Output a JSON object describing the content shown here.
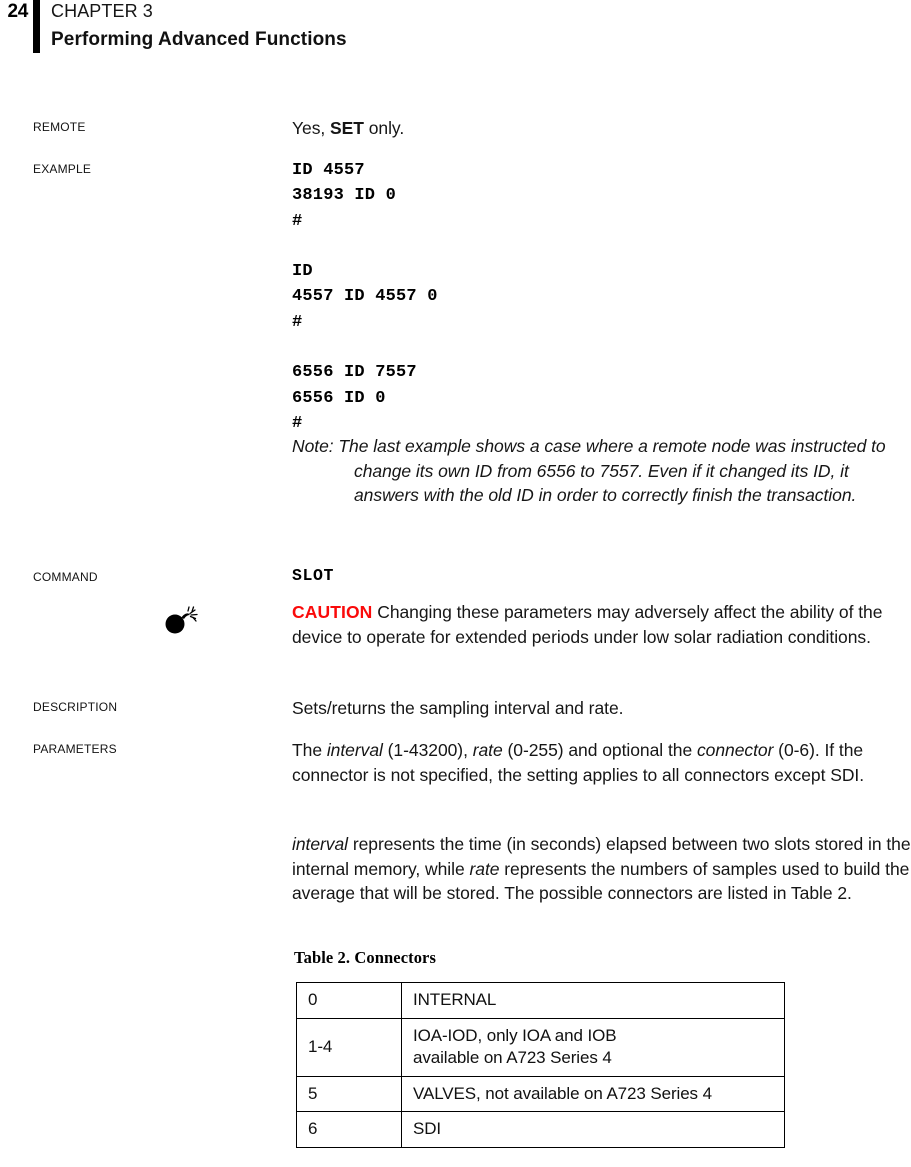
{
  "header": {
    "page_number": "24",
    "chapter_label": "CHAPTER 3",
    "chapter_title": "Performing Advanced Functions"
  },
  "entries": {
    "remote": {
      "label": "Remote",
      "text_prefix": "Yes, ",
      "text_bold": "SET",
      "text_suffix": " only."
    },
    "example": {
      "label": "Example",
      "code": "ID 4557\n38193 ID 0\n#\n\nID\n4557 ID 4557 0\n#\n\n6556 ID 7557\n6556 ID 0\n#",
      "note": "Note: The last example shows a case where a remote node was instructed to change its own ID from 6556 to 7557. Even if it changed its ID, it answers with the old ID in order to correctly finish the transaction."
    },
    "command": {
      "label": "Command",
      "name": "SLOT",
      "caution_word": "CAUTION",
      "caution_text": " Changing these parameters may adversely affect the ability of the device to operate for extended periods under low solar radiation conditions."
    },
    "description": {
      "label": "Description",
      "text": "Sets/returns the sampling interval and rate."
    },
    "parameters": {
      "label": "Parameters",
      "para1_a": "The ",
      "para1_i1": "interval",
      "para1_b": " (1-43200), ",
      "para1_i2": "rate",
      "para1_c": " (0-255) and optional the ",
      "para1_i3": "connector",
      "para1_d": " (0-6). If the connector is not specified, the setting applies to all connectors except SDI.",
      "para2_i1": "interval",
      "para2_a": " represents the time (in seconds) elapsed between two slots stored in the internal memory, while ",
      "para2_i2": "rate",
      "para2_b": " represents the numbers of samples used to build the average that will be stored. The possible connectors are listed in Table 2."
    }
  },
  "table": {
    "caption": "Table 2.  Connectors",
    "rows": [
      {
        "key": "0",
        "value_line1": "INTERNAL",
        "value_line2": ""
      },
      {
        "key": "1-4",
        "value_line1": "IOA-IOD, only IOA and IOB",
        "value_line2": "available on A723 Series 4"
      },
      {
        "key": "5",
        "value_line1": "VALVES, not available on A723 Series 4",
        "value_line2": ""
      },
      {
        "key": "6",
        "value_line1": "SDI",
        "value_line2": ""
      }
    ]
  },
  "colors": {
    "caution_red": "#FA0A0A",
    "text_black": "#161616",
    "rule_black": "#000000"
  }
}
